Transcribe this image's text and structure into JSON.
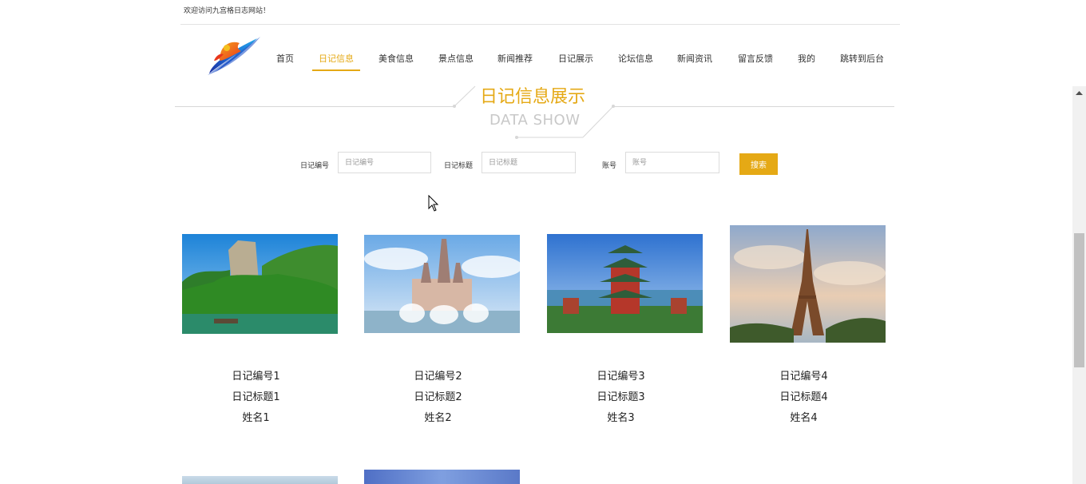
{
  "header": {
    "welcome": "欢迎访问九宫格日志网站！"
  },
  "nav": {
    "items": [
      {
        "label": "首页"
      },
      {
        "label": "日记信息"
      },
      {
        "label": "美食信息"
      },
      {
        "label": "景点信息"
      },
      {
        "label": "新闻推荐"
      },
      {
        "label": "日记展示"
      },
      {
        "label": "论坛信息"
      },
      {
        "label": "新闻资讯"
      },
      {
        "label": "留言反馈"
      },
      {
        "label": "我的"
      },
      {
        "label": "跳转到后台"
      }
    ],
    "active_index": 1
  },
  "section": {
    "title": "日记信息展示",
    "subtitle": "DATA SHOW"
  },
  "search": {
    "fields": [
      {
        "label": "日记编号",
        "placeholder": "日记编号",
        "value": ""
      },
      {
        "label": "日记标题",
        "placeholder": "日记标题",
        "value": ""
      },
      {
        "label": "账号",
        "placeholder": "账号",
        "value": ""
      }
    ],
    "button_label": "搜索"
  },
  "cards": [
    {
      "code": "日记编号1",
      "title": "日记标题1",
      "name": "姓名1",
      "image": "mountain-river-photo"
    },
    {
      "code": "日记编号2",
      "title": "日记标题2",
      "name": "姓名2",
      "image": "castle-photo"
    },
    {
      "code": "日记编号3",
      "title": "日记标题3",
      "name": "姓名3",
      "image": "pagoda-pavilion-photo"
    },
    {
      "code": "日记编号4",
      "title": "日记标题4",
      "name": "姓名4",
      "image": "eiffel-tower-photo"
    }
  ],
  "colors": {
    "accent": "#e5a915",
    "divider": "#d7d7d7"
  }
}
